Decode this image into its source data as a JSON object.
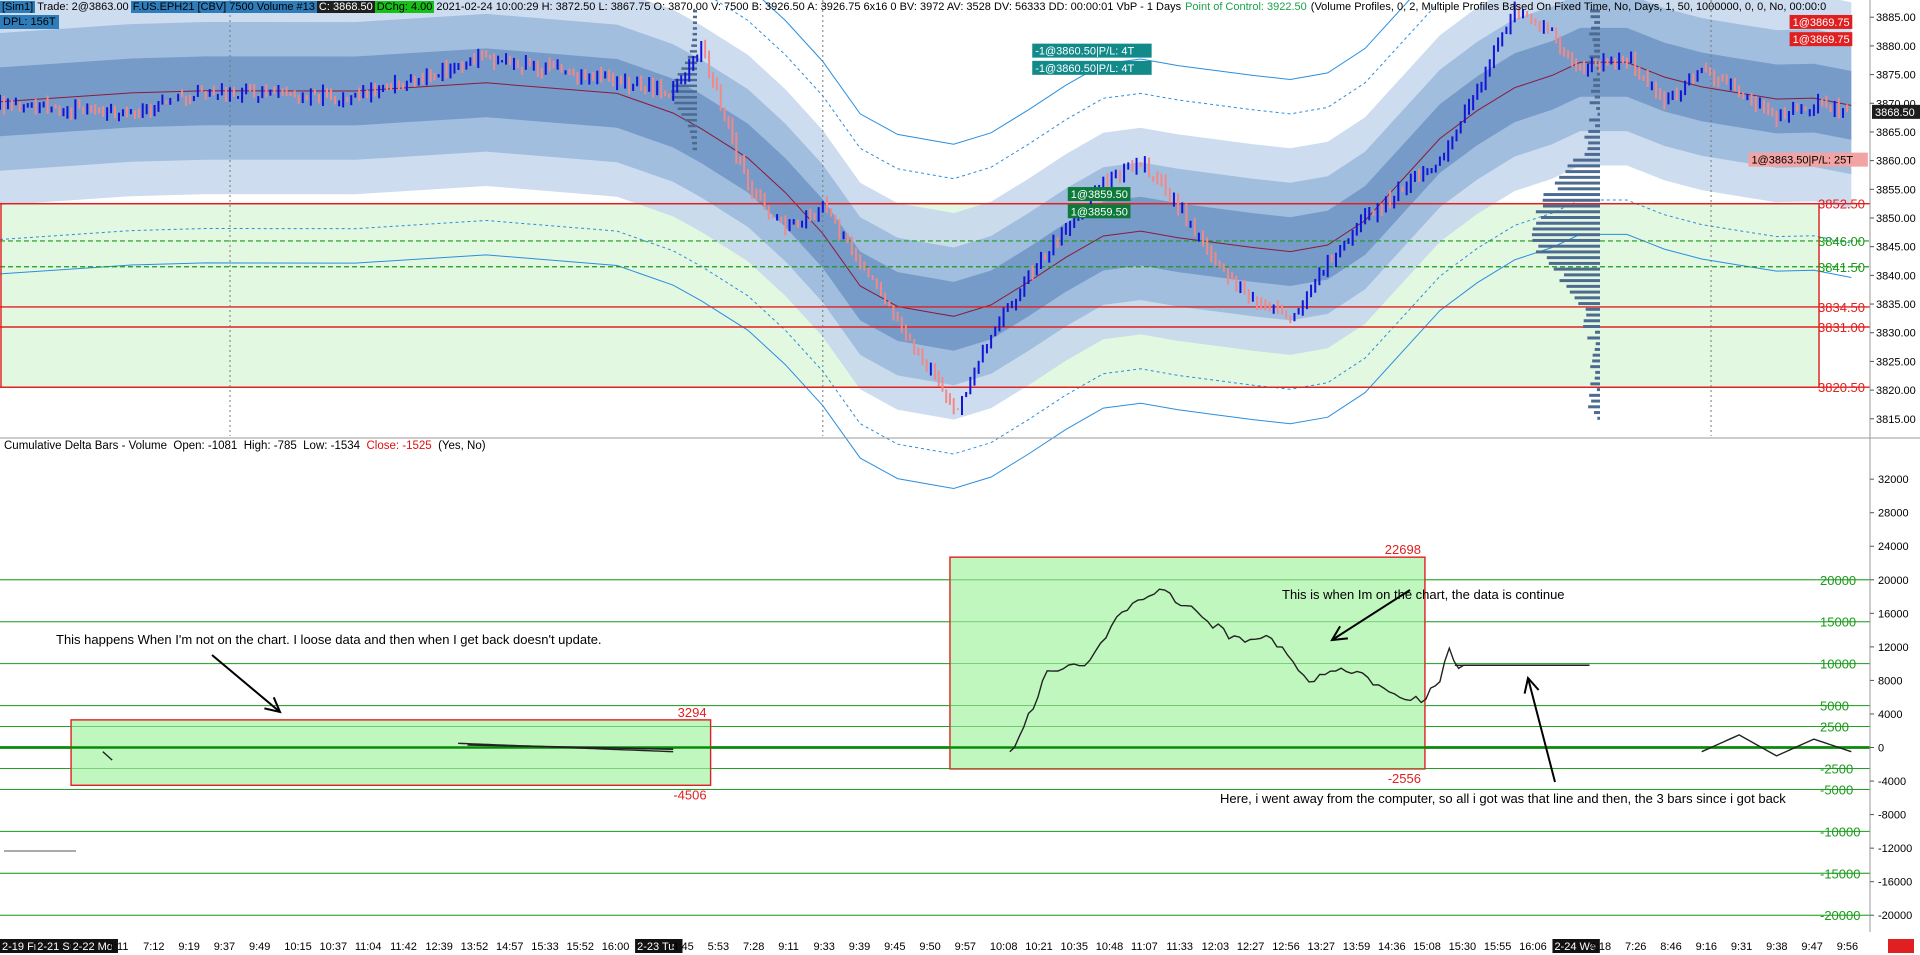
{
  "header": {
    "sim": "[Sim1]",
    "trade": "Trade: 2@3863.00",
    "instrument": "F.US.EPH21 [CBV]  7500 Volume  #13",
    "close": "C: 3868.50",
    "dchg": "DChg: 4.00",
    "stats": "2021-02-24 10:00:29  H: 3872.50  L: 3867.75  O: 3870.00  V: 7500  B: 3926.50  A: 3926.75  6x16 0  BV: 3972  AV: 3528  DV: 56333  DD: 00:00:01  VbP - 1 Days",
    "poc": "Point of Control: 3922.50",
    "study": "(Volume Profiles, 0, 2, Multiple Profiles Based On Fixed Time, No, Days, 1, 50, 1000000, 0, 0, No, 00:00:0",
    "dpl": "DPL: 156T"
  },
  "subchart_header": {
    "name": "Cumulative Delta Bars - Volume",
    "open": "Open: -1081",
    "high": "High: -785",
    "low": "Low: -1534",
    "close": "Close: -1525",
    "flags": "(Yes, No)"
  },
  "price_axis": {
    "ticks": [
      3885,
      3880,
      3875,
      3870,
      3865,
      3860,
      3855,
      3850,
      3845,
      3840,
      3835,
      3830,
      3825,
      3820,
      3815
    ],
    "tick_labels": [
      "3885.00",
      "3880.00",
      "3875.00",
      "3870.00",
      "3865.00",
      "3860.00",
      "3855.00",
      "3850.00",
      "3845.00",
      "3840.00",
      "3835.00",
      "3830.00",
      "3825.00",
      "3820.00",
      "3815.00"
    ],
    "current_price": "3868.50"
  },
  "price_levels": [
    {
      "label": "3852.50",
      "value": 3852.5,
      "color": "#e02020"
    },
    {
      "label": "3846.00",
      "value": 3846.0,
      "color": "#1a9a1a"
    },
    {
      "label": "3841.50",
      "value": 3841.5,
      "color": "#1a9a1a"
    },
    {
      "label": "3834.50",
      "value": 3834.5,
      "color": "#e02020"
    },
    {
      "label": "3831.00",
      "value": 3831.0,
      "color": "#e02020"
    },
    {
      "label": "3820.50",
      "value": 3820.5,
      "color": "#e02020"
    }
  ],
  "order_tags": [
    {
      "text": "-1@3860.50|P/L: 4T",
      "bg": "#138a8a"
    },
    {
      "text": "-1@3860.50|P/L: 4T",
      "bg": "#138a8a"
    },
    {
      "text": "1@3859.50",
      "bg": "#0e7a3a"
    },
    {
      "text": "1@3859.50",
      "bg": "#0e7a3a"
    },
    {
      "text": "1@3869.75",
      "bg": "#e02020"
    },
    {
      "text": "1@3869.75",
      "bg": "#e02020"
    },
    {
      "text": "1@3863.50|P/L: 25T",
      "bg": "#f2a3a3"
    }
  ],
  "delta_axis": {
    "ticks": [
      32000,
      28000,
      24000,
      20000,
      16000,
      12000,
      8000,
      4000,
      0,
      -4000,
      -8000,
      -12000,
      -16000,
      -20000
    ],
    "tick_labels": [
      "32000",
      "28000",
      "24000",
      "20000",
      "16000",
      "12000",
      "8000",
      "4000",
      "0",
      "-4000",
      "-8000",
      "-12000",
      "-16000",
      "-20000"
    ],
    "green_levels": [
      {
        "label": "20000",
        "value": 20000
      },
      {
        "label": "15000",
        "value": 15000
      },
      {
        "label": "10000",
        "value": 10000
      },
      {
        "label": "5000",
        "value": 5000
      },
      {
        "label": "2500",
        "value": 2500
      },
      {
        "label": "-2500",
        "value": -2500
      },
      {
        "label": "-5000",
        "value": -5000
      },
      {
        "label": "-10000",
        "value": -10000
      },
      {
        "label": "-15000",
        "value": -15000
      },
      {
        "label": "-20000",
        "value": -20000
      }
    ]
  },
  "delta_boxes": [
    {
      "high_label": "3294",
      "low_label": "-4506",
      "high": 3294,
      "low": -4506
    },
    {
      "high_label": "22698",
      "low_label": "-2556",
      "high": 22698,
      "low": -2556
    }
  ],
  "annotations": [
    "This happens When I'm not on the chart. I loose data and then when I get back doesn't update.",
    "This is when Im on the chart, the data is continue",
    "Here, i went away from the computer, so all i got was that line and then, the 3 bars since i got back"
  ],
  "time_axis": {
    "labels": [
      {
        "text": "2-19 Fr",
        "session": true
      },
      {
        "text": "2-21 Su",
        "session": true
      },
      {
        "text": "2-22 Mo",
        "session": true
      },
      {
        "text": "4:11",
        "session": false
      },
      {
        "text": "7:12",
        "session": false
      },
      {
        "text": "9:19",
        "session": false
      },
      {
        "text": "9:37",
        "session": false
      },
      {
        "text": "9:49",
        "session": false
      },
      {
        "text": "10:15",
        "session": false
      },
      {
        "text": "10:37",
        "session": false
      },
      {
        "text": "11:04",
        "session": false
      },
      {
        "text": "11:42",
        "session": false
      },
      {
        "text": "12:39",
        "session": false
      },
      {
        "text": "13:52",
        "session": false
      },
      {
        "text": "14:57",
        "session": false
      },
      {
        "text": "15:33",
        "session": false
      },
      {
        "text": "15:52",
        "session": false
      },
      {
        "text": "16:00",
        "session": false
      },
      {
        "text": "2-23 Tu",
        "session": true
      },
      {
        "text": "4:45",
        "session": false
      },
      {
        "text": "5:53",
        "session": false
      },
      {
        "text": "7:28",
        "session": false
      },
      {
        "text": "9:11",
        "session": false
      },
      {
        "text": "9:33",
        "session": false
      },
      {
        "text": "9:39",
        "session": false
      },
      {
        "text": "9:45",
        "session": false
      },
      {
        "text": "9:50",
        "session": false
      },
      {
        "text": "9:57",
        "session": false
      },
      {
        "text": "10:08",
        "session": false
      },
      {
        "text": "10:21",
        "session": false
      },
      {
        "text": "10:35",
        "session": false
      },
      {
        "text": "10:48",
        "session": false
      },
      {
        "text": "11:07",
        "session": false
      },
      {
        "text": "11:33",
        "session": false
      },
      {
        "text": "12:03",
        "session": false
      },
      {
        "text": "12:27",
        "session": false
      },
      {
        "text": "12:56",
        "session": false
      },
      {
        "text": "13:27",
        "session": false
      },
      {
        "text": "13:59",
        "session": false
      },
      {
        "text": "14:36",
        "session": false
      },
      {
        "text": "15:08",
        "session": false
      },
      {
        "text": "15:30",
        "session": false
      },
      {
        "text": "15:55",
        "session": false
      },
      {
        "text": "16:06",
        "session": false
      },
      {
        "text": "2-24 We",
        "session": true
      },
      {
        "text": "4:18",
        "session": false
      },
      {
        "text": "7:26",
        "session": false
      },
      {
        "text": "8:46",
        "session": false
      },
      {
        "text": "9:16",
        "session": false
      },
      {
        "text": "9:31",
        "session": false
      },
      {
        "text": "9:38",
        "session": false
      },
      {
        "text": "9:47",
        "session": false
      },
      {
        "text": "9:56",
        "session": false
      }
    ]
  },
  "colors": {
    "up_bar": "#1414d8",
    "down_bar": "#f08a8a",
    "band_light": "#c5d6ec",
    "band_mid": "#9ab8dc",
    "band_dark": "#6f95c4",
    "teal_band": "#a9cfd6",
    "zone_fill": "#e3f8e0",
    "box_fill": "#bff7bf",
    "level_red": "#e02020",
    "level_green": "#1a9a1a",
    "vwap": "#8b1a3a",
    "profile": "#4d6b90"
  },
  "chart_data": [
    {
      "type": "candlestick",
      "title": "",
      "xlabel": "",
      "ylabel": "",
      "ylim": [
        3812,
        3888
      ],
      "grid": false,
      "x": [
        0,
        0.07,
        0.11,
        0.19,
        0.26,
        0.33,
        0.36,
        0.375,
        0.4,
        0.42,
        0.44,
        0.46,
        0.48,
        0.5,
        0.51,
        0.53,
        0.55,
        0.57,
        0.59,
        0.61,
        0.63,
        0.65,
        0.67,
        0.69,
        0.71,
        0.73,
        0.75,
        0.77,
        0.79,
        0.81,
        0.83,
        0.845,
        0.87,
        0.89,
        0.91,
        0.93,
        0.95,
        0.97,
        0.99
      ],
      "series": [
        {
          "values": [
            3870,
            3868,
            3872,
            3871,
            3878,
            3874,
            3872,
            3880,
            3855,
            3848,
            3852,
            3842,
            3832,
            3822,
            3816,
            3830,
            3840,
            3848,
            3856,
            3860,
            3852,
            3842,
            3836,
            3832,
            3842,
            3850,
            3855,
            3860,
            3872,
            3886,
            3882,
            3876,
            3878,
            3870,
            3876,
            3872,
            3868,
            3870,
            3868.5
          ]
        }
      ]
    },
    {
      "type": "line",
      "title": "",
      "xlabel": "",
      "ylabel": "",
      "ylim": [
        -22000,
        35000
      ],
      "grid": false,
      "x": [
        0.055,
        0.06,
        0.245,
        0.36,
        0.54,
        0.545,
        0.56,
        0.58,
        0.6,
        0.62,
        0.64,
        0.66,
        0.68,
        0.7,
        0.72,
        0.74,
        0.76,
        0.77,
        0.775,
        0.78,
        0.85,
        0.855,
        0.91,
        0.93,
        0.95,
        0.97,
        0.99
      ],
      "series": [
        {
          "values": [
            -500,
            -1500,
            500,
            -500,
            -500,
            1000,
            9000,
            10000,
            16000,
            19000,
            16000,
            13000,
            13000,
            8000,
            9500,
            7000,
            5500,
            8000,
            11500,
            9800,
            9800,
            7800,
            -500,
            1500,
            -1000,
            1000,
            -500
          ]
        }
      ]
    }
  ]
}
